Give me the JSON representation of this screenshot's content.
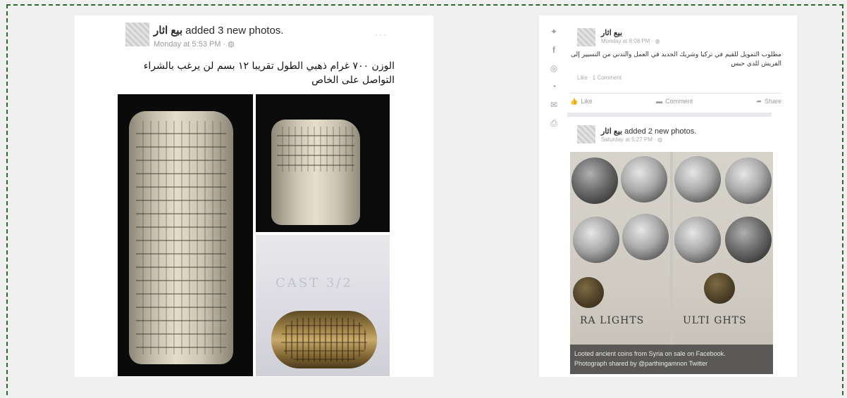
{
  "left_post": {
    "page_name": "بيع اثار",
    "action_text": " added 3 new photos.",
    "timestamp": "Monday at 5:53 PM · ",
    "menu": "···",
    "body_text": "الوزن ٧٠٠ غرام ذهبي الطول تقريبا ١٢ بسم لن يرغب بالشراء التواصل على الخاص",
    "watermark": "CAST 3/2"
  },
  "right_sidebar": {
    "icons": [
      "twitter-icon",
      "facebook-icon",
      "pinterest-icon",
      "reddit-icon",
      "email-icon",
      "print-icon"
    ]
  },
  "right_post_1": {
    "page_name": "بيع اثار",
    "timestamp": "Monday at 8:08 PM · ",
    "body_text": "مطلوب التمويل للقيم في تركيا وشريك الجديد في العمل والتدني من التسيير إلى الفريش للذي حبس",
    "like_row": "Like · 1 Comment",
    "actions": [
      "Like",
      "Comment",
      "Share"
    ]
  },
  "right_post_2": {
    "page_name": "بيع اثار",
    "action_text": " added 2 new photos.",
    "timestamp": "Saturday at 5:27 PM · ",
    "book_words": [
      "RA LIGHTS",
      "ULTI GHTS"
    ],
    "caption_line1": "Looted ancient coins from Syria on sale on Facebook.",
    "caption_line2": "Photograph shared by @parthingamnon Twitter"
  },
  "colors": {
    "frame_border": "#2a6a2a",
    "page_background": "#f0f0f0",
    "card_background": "#ffffff"
  }
}
